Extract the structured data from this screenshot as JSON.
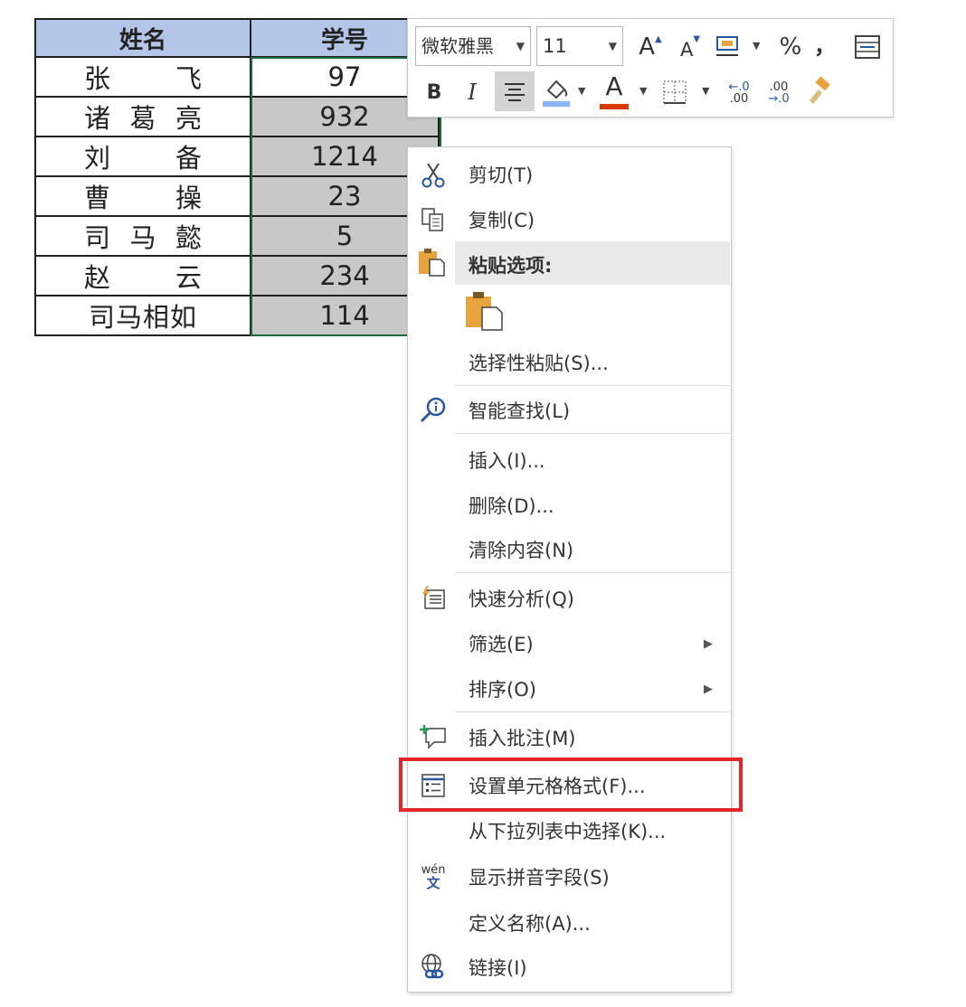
{
  "sheet": {
    "headers": [
      "姓名",
      "学号"
    ],
    "rows": [
      {
        "name_a": "张",
        "name_b": "飞",
        "name": "张 飞",
        "id": "97"
      },
      {
        "name": "诸 葛 亮",
        "chars": [
          "诸",
          "葛",
          "亮"
        ],
        "id": "932"
      },
      {
        "name_a": "刘",
        "name_b": "备",
        "name": "刘 备",
        "id": "1214"
      },
      {
        "name_a": "曹",
        "name_b": "操",
        "name": "曹 操",
        "id": "23"
      },
      {
        "name": "司 马 懿",
        "chars": [
          "司",
          "马",
          "懿"
        ],
        "id": "5"
      },
      {
        "name_a": "赵",
        "name_b": "云",
        "name": "赵 云",
        "id": "234"
      },
      {
        "name": "司马相如",
        "id": "114"
      }
    ]
  },
  "mini_toolbar": {
    "font_name": "微软雅黑",
    "font_size": "11",
    "grow_font": "A",
    "shrink_font": "A",
    "percent": "%",
    "comma": "，",
    "bold": "B",
    "italic": "I",
    "font_color_letter": "A",
    "inc_decimal_top": "←.0",
    "inc_decimal_bottom": ".00",
    "dec_decimal_top": ".00",
    "dec_decimal_bottom": "→.0"
  },
  "context_menu": {
    "cut": "剪切(T)",
    "copy": "复制(C)",
    "paste_options": "粘贴选项:",
    "paste_special": "选择性粘贴(S)...",
    "smart_lookup": "智能查找(L)",
    "insert": "插入(I)...",
    "delete": "删除(D)...",
    "clear_contents": "清除内容(N)",
    "quick_analysis": "快速分析(Q)",
    "filter": "筛选(E)",
    "sort": "排序(O)",
    "insert_comment": "插入批注(M)",
    "format_cells": "设置单元格格式(F)...",
    "pick_from_list": "从下拉列表中选择(K)...",
    "phonetic": "显示拼音字段(S)",
    "define_name": "定义名称(A)...",
    "link": "链接(I)",
    "phonetic_icon_top": "wén",
    "phonetic_icon_bottom": "文"
  },
  "colors": {
    "header_fill": "#b4c6e7",
    "selection_fill": "#c8c8c8",
    "selection_border": "#1e6b3a",
    "highlight_box": "#e4262b",
    "font_color_bar": "#d83b01",
    "fill_color_bar": "#8ab4f8"
  }
}
